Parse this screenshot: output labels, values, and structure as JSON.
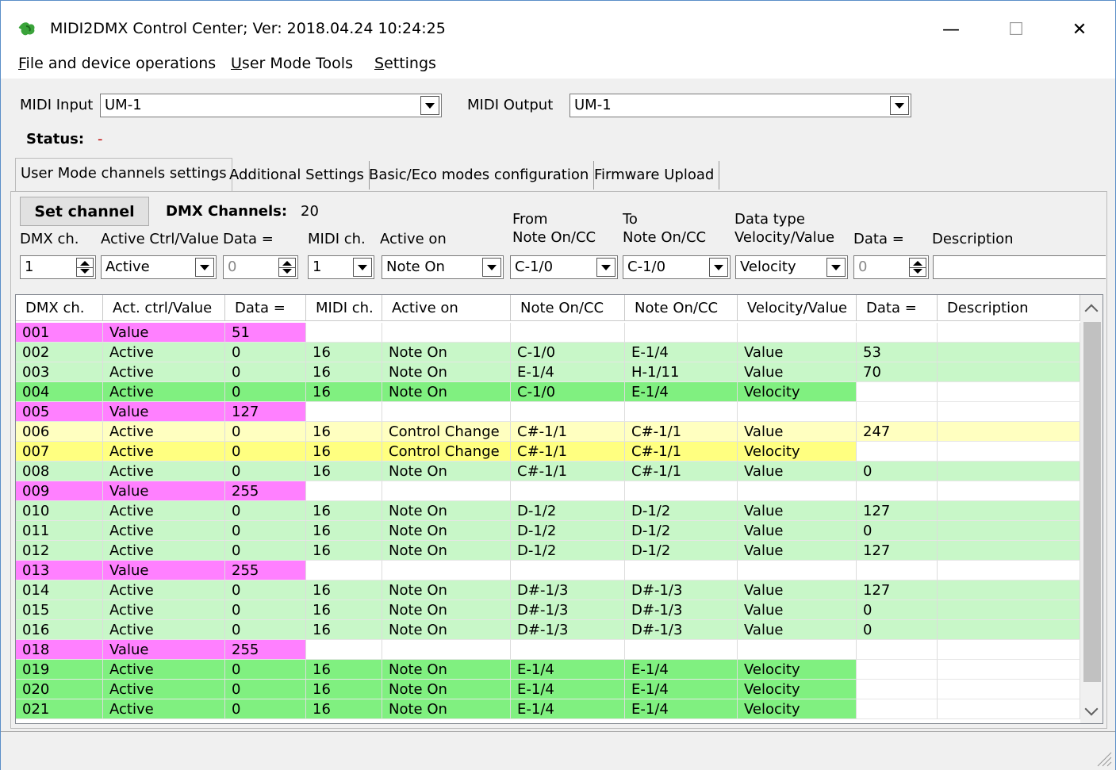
{
  "window": {
    "title": "MIDI2DMX Control Center; Ver: 2018.04.24 10:24:25",
    "minimize_glyph": "—",
    "maximize_glyph": "☐",
    "close_glyph": "✕"
  },
  "menu": {
    "items": [
      {
        "key": "F",
        "rest": "ile and device operations"
      },
      {
        "key": "U",
        "rest": "ser Mode Tools"
      },
      {
        "key": "S",
        "rest": "ettings"
      }
    ]
  },
  "io": {
    "midi_input_label": "MIDI Input",
    "midi_input_value": "UM-1",
    "midi_output_label": "MIDI Output",
    "midi_output_value": "UM-1",
    "status_label": "Status:",
    "status_value": "-"
  },
  "tabs": [
    {
      "label": "User Mode channels settings",
      "active": true
    },
    {
      "label": "Additional Settings",
      "active": false
    },
    {
      "label": "Basic/Eco modes configuration",
      "active": false
    },
    {
      "label": "Firmware Upload",
      "active": false
    }
  ],
  "editor": {
    "set_channel_label": "Set channel",
    "dmx_channels_label": "DMX Channels:",
    "dmx_channels_value": "20",
    "labels": {
      "dmx_ch": "DMX ch.",
      "active_ctrl": "Active Ctrl/Value",
      "data1": "Data =",
      "midi_ch": "MIDI ch.",
      "active_on": "Active on",
      "from_top": "From",
      "from_bottom": "Note On/CC",
      "to_top": "To",
      "to_bottom": "Note On/CC",
      "dtype_top": "Data type",
      "dtype_bottom": "Velocity/Value",
      "data2": "Data =",
      "description": "Description"
    },
    "values": {
      "dmx_ch": "1",
      "active_ctrl": "Active",
      "data1": "0",
      "midi_ch": "1",
      "active_on": "Note On",
      "from": "C-1/0",
      "to": "C-1/0",
      "dtype": "Velocity",
      "data2": "0",
      "description": ""
    }
  },
  "grid": {
    "columns": [
      "DMX ch.",
      "Act. ctrl/Value",
      "Data =",
      "MIDI ch.",
      "Active on",
      "Note On/CC",
      "Note On/CC",
      "Velocity/Value",
      "Data =",
      "Description"
    ],
    "colors": {
      "magenta": "#ff80ff",
      "green_light": "#c8f7c8",
      "green": "#80f080",
      "yellow_light": "#ffffc0",
      "yellow": "#ffff80"
    },
    "rows": [
      {
        "cells": [
          "001",
          "Value",
          "51",
          "",
          "",
          "",
          "",
          "",
          "",
          ""
        ],
        "style": "value"
      },
      {
        "cells": [
          "002",
          "Active",
          "0",
          "16",
          "Note On",
          "C-1/0",
          "E-1/4",
          "Value",
          "53",
          ""
        ],
        "style": "green_light"
      },
      {
        "cells": [
          "003",
          "Active",
          "0",
          "16",
          "Note On",
          "E-1/4",
          "H-1/11",
          "Value",
          "70",
          ""
        ],
        "style": "green_light"
      },
      {
        "cells": [
          "004",
          "Active",
          "0",
          "16",
          "Note On",
          "C-1/0",
          "E-1/4",
          "Velocity",
          "",
          ""
        ],
        "style": "green"
      },
      {
        "cells": [
          "005",
          "Value",
          "127",
          "",
          "",
          "",
          "",
          "",
          "",
          ""
        ],
        "style": "value"
      },
      {
        "cells": [
          "006",
          "Active",
          "0",
          "16",
          "Control Change",
          "C#-1/1",
          "C#-1/1",
          "Value",
          "247",
          ""
        ],
        "style": "yellow_light"
      },
      {
        "cells": [
          "007",
          "Active",
          "0",
          "16",
          "Control Change",
          "C#-1/1",
          "C#-1/1",
          "Velocity",
          "",
          ""
        ],
        "style": "yellow"
      },
      {
        "cells": [
          "008",
          "Active",
          "0",
          "16",
          "Note On",
          "C#-1/1",
          "C#-1/1",
          "Value",
          "0",
          ""
        ],
        "style": "green_light"
      },
      {
        "cells": [
          "009",
          "Value",
          "255",
          "",
          "",
          "",
          "",
          "",
          "",
          ""
        ],
        "style": "value"
      },
      {
        "cells": [
          "010",
          "Active",
          "0",
          "16",
          "Note On",
          "D-1/2",
          "D-1/2",
          "Value",
          "127",
          ""
        ],
        "style": "green_light"
      },
      {
        "cells": [
          "011",
          "Active",
          "0",
          "16",
          "Note On",
          "D-1/2",
          "D-1/2",
          "Value",
          "0",
          ""
        ],
        "style": "green_light"
      },
      {
        "cells": [
          "012",
          "Active",
          "0",
          "16",
          "Note On",
          "D-1/2",
          "D-1/2",
          "Value",
          "127",
          ""
        ],
        "style": "green_light"
      },
      {
        "cells": [
          "013",
          "Value",
          "255",
          "",
          "",
          "",
          "",
          "",
          "",
          ""
        ],
        "style": "value"
      },
      {
        "cells": [
          "014",
          "Active",
          "0",
          "16",
          "Note On",
          "D#-1/3",
          "D#-1/3",
          "Value",
          "127",
          ""
        ],
        "style": "green_light"
      },
      {
        "cells": [
          "015",
          "Active",
          "0",
          "16",
          "Note On",
          "D#-1/3",
          "D#-1/3",
          "Value",
          "0",
          ""
        ],
        "style": "green_light"
      },
      {
        "cells": [
          "016",
          "Active",
          "0",
          "16",
          "Note On",
          "D#-1/3",
          "D#-1/3",
          "Value",
          "0",
          ""
        ],
        "style": "green_light"
      },
      {
        "cells": [
          "018",
          "Value",
          "255",
          "",
          "",
          "",
          "",
          "",
          "",
          ""
        ],
        "style": "value"
      },
      {
        "cells": [
          "019",
          "Active",
          "0",
          "16",
          "Note On",
          "E-1/4",
          "E-1/4",
          "Velocity",
          "",
          ""
        ],
        "style": "green"
      },
      {
        "cells": [
          "020",
          "Active",
          "0",
          "16",
          "Note On",
          "E-1/4",
          "E-1/4",
          "Velocity",
          "",
          ""
        ],
        "style": "green"
      },
      {
        "cells": [
          "021",
          "Active",
          "0",
          "16",
          "Note On",
          "E-1/4",
          "E-1/4",
          "Velocity",
          "",
          ""
        ],
        "style": "green"
      }
    ]
  }
}
